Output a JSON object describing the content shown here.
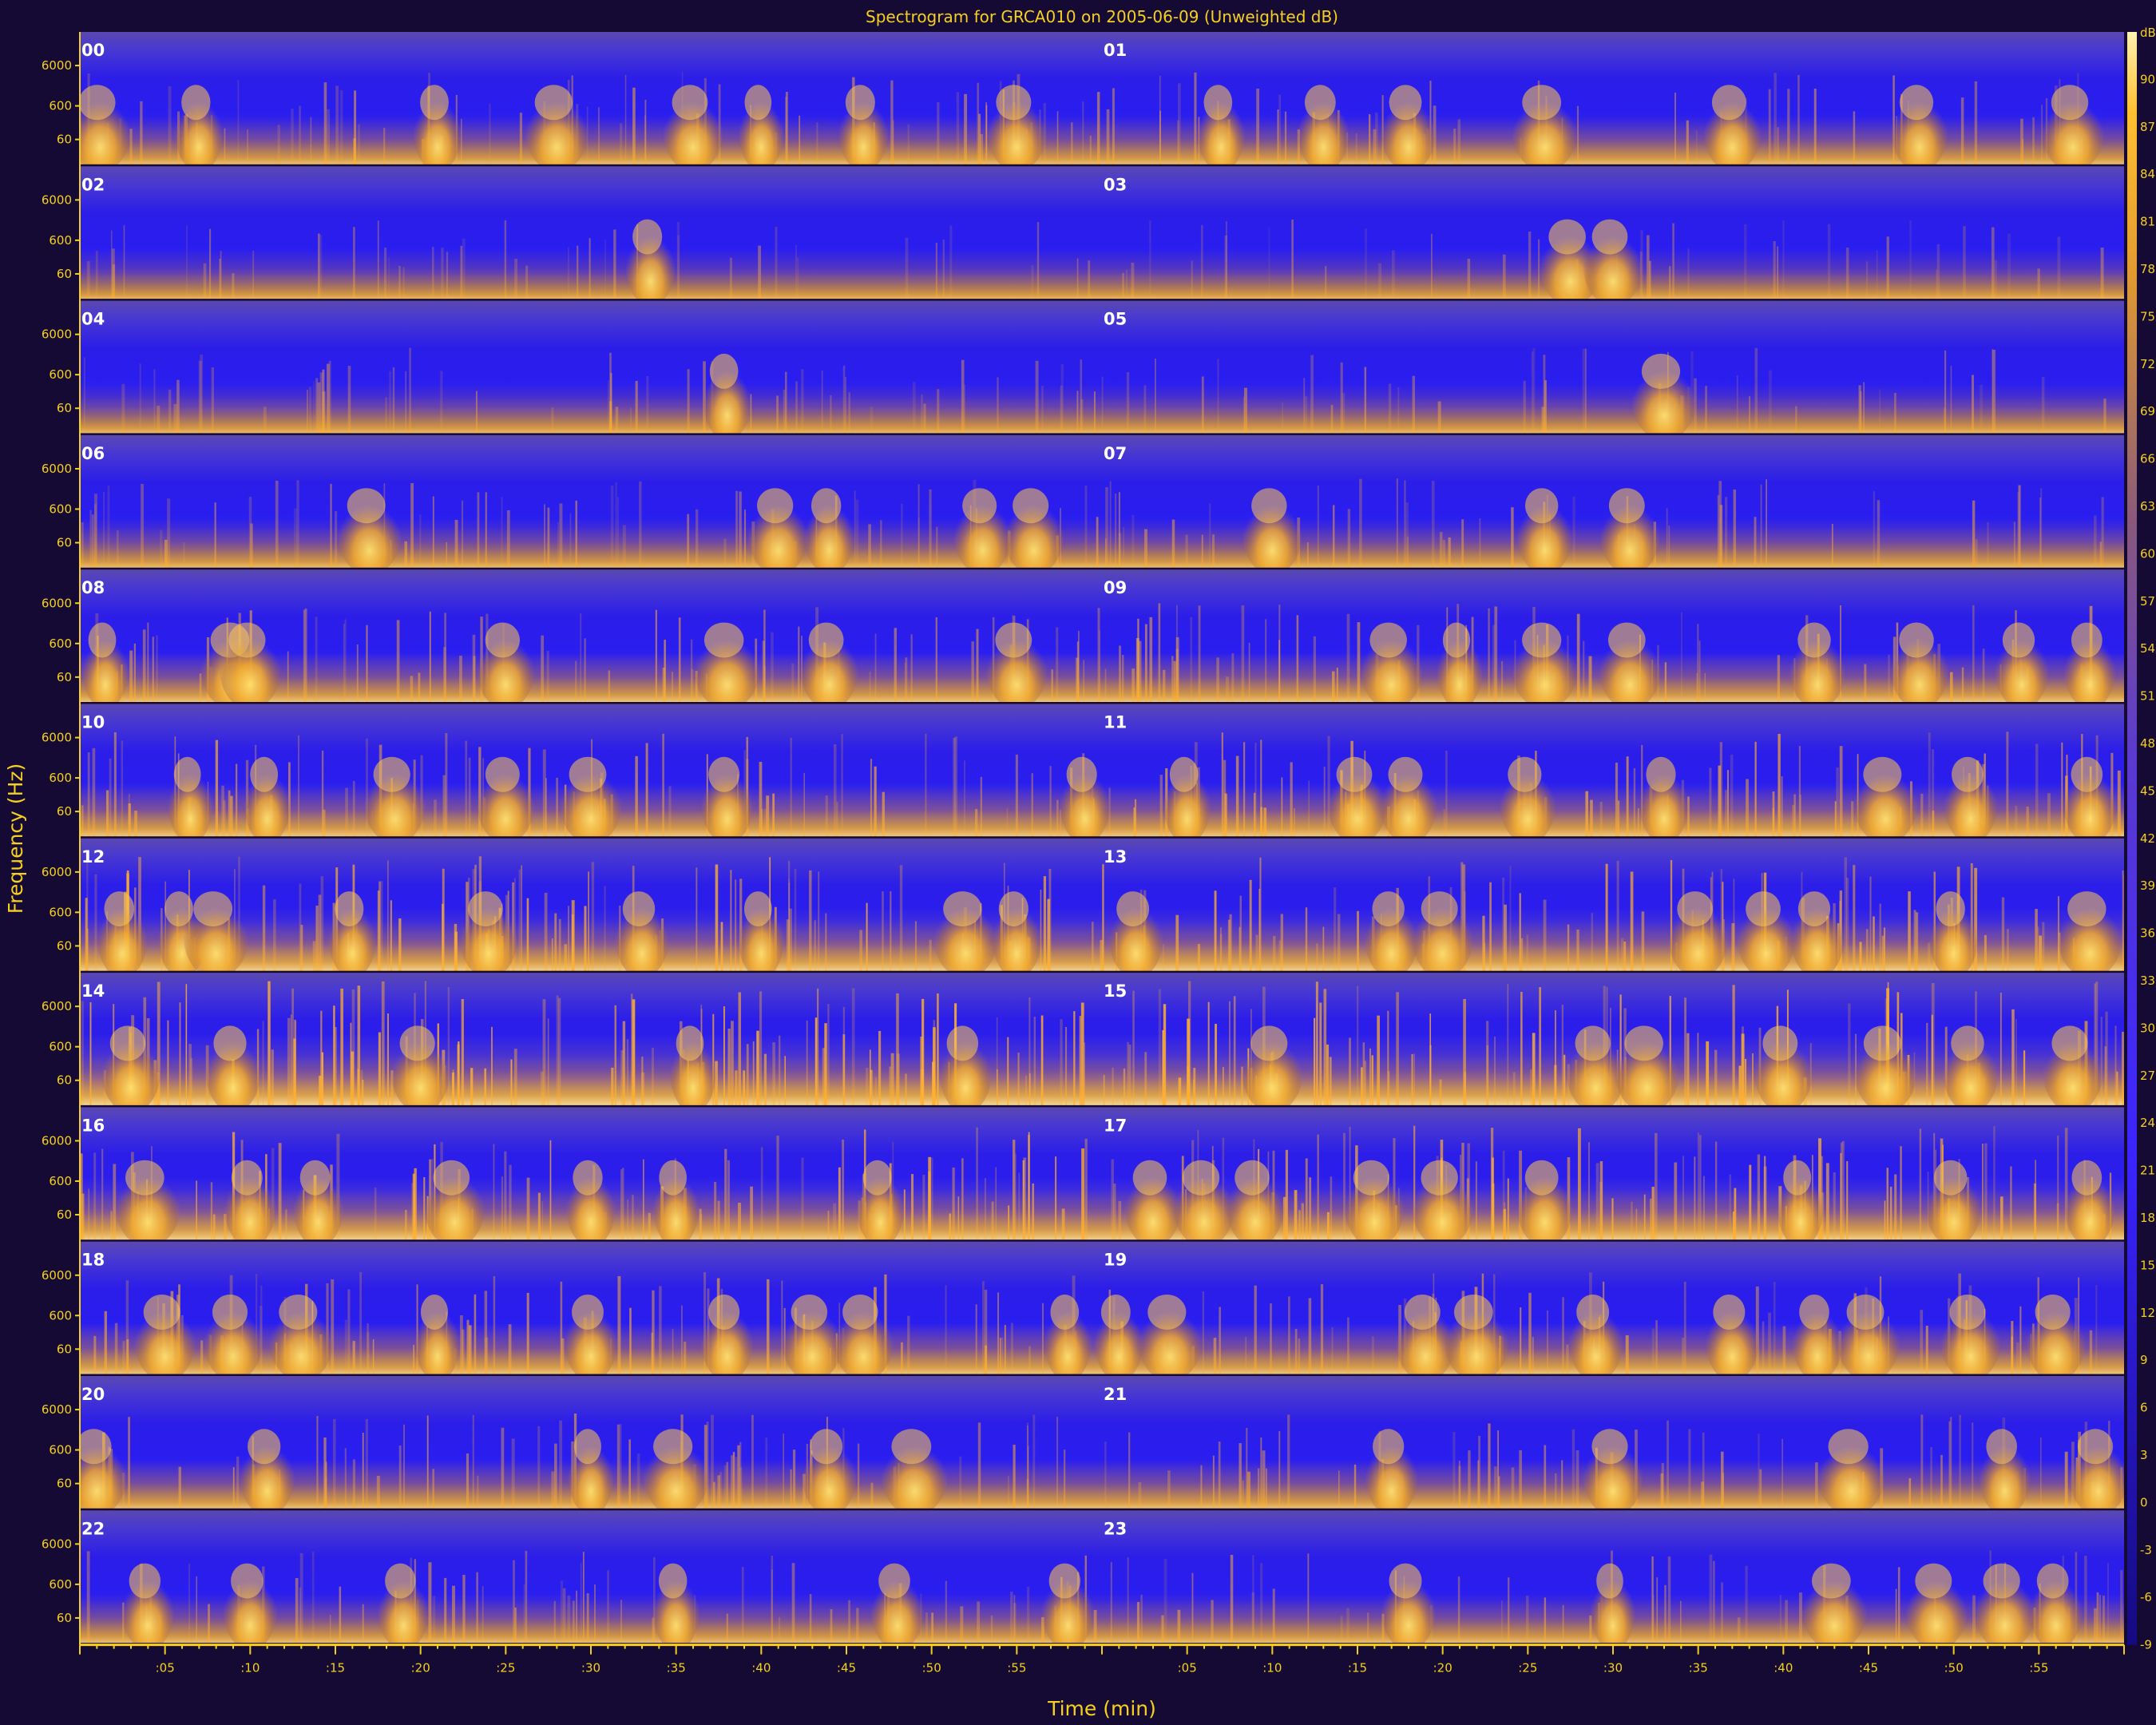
{
  "chart_data": {
    "type": "heatmap",
    "title": "Spectrogram for GRCA010 on 2005-06-09 (Unweighted dB)",
    "xlabel": "Time (min)",
    "ylabel": "Frequency (Hz)",
    "colorbar_unit": "dB",
    "y_tick_labels": [
      "6000",
      "600",
      "60"
    ],
    "x_tick_labels": [
      ":05",
      ":10",
      ":15",
      ":20",
      ":25",
      ":30",
      ":35",
      ":40",
      ":45",
      ":50",
      ":55"
    ],
    "hour_labels": [
      "00",
      "01",
      "02",
      "03",
      "04",
      "05",
      "06",
      "07",
      "08",
      "09",
      "10",
      "11",
      "12",
      "13",
      "14",
      "15",
      "16",
      "17",
      "18",
      "19",
      "20",
      "21",
      "22",
      "23"
    ],
    "colorbar_ticks": [
      90,
      87,
      84,
      81,
      78,
      75,
      72,
      69,
      66,
      63,
      60,
      57,
      54,
      51,
      48,
      45,
      42,
      39,
      36,
      33,
      30,
      27,
      24,
      21,
      18,
      15,
      12,
      9,
      6,
      3,
      0,
      -3,
      -6,
      -9
    ],
    "colorbar_range": [
      -9,
      93
    ],
    "x_range_min": [
      0,
      60
    ],
    "colors": {
      "background": "#140a33",
      "low": "#2b1ee6",
      "mid": "#a0703a",
      "high": "#ffb020",
      "peak": "#fff6c8",
      "text": "#f5d020"
    },
    "panels": [
      {
        "hours": [
          "00",
          "01"
        ],
        "loudness": 0.35,
        "events": [
          1.2,
          7,
          21,
          28,
          36,
          40,
          46,
          55,
          67,
          73,
          78,
          86,
          97,
          108,
          117
        ]
      },
      {
        "hours": [
          "02",
          "03"
        ],
        "loudness": 0.15,
        "events": [
          33.5,
          87.5,
          90
        ]
      },
      {
        "hours": [
          "04",
          "05"
        ],
        "loudness": 0.25,
        "events": [
          38,
          93
        ]
      },
      {
        "hours": [
          "06",
          "07"
        ],
        "loudness": 0.3,
        "events": [
          17,
          41,
          44,
          53,
          56,
          70,
          86,
          91
        ]
      },
      {
        "hours": [
          "08",
          "09"
        ],
        "loudness": 0.45,
        "events": [
          1.5,
          9,
          10,
          25,
          38,
          44,
          55,
          77,
          81,
          86,
          91,
          102,
          108,
          114,
          118
        ]
      },
      {
        "hours": [
          "10",
          "11"
        ],
        "loudness": 0.55,
        "events": [
          6.5,
          11,
          18.5,
          25,
          30,
          38,
          59,
          65,
          75,
          78,
          85,
          93,
          106,
          111,
          118
        ]
      },
      {
        "hours": [
          "12",
          "13"
        ],
        "loudness": 0.7,
        "events": [
          2.5,
          6,
          8,
          16,
          24,
          33,
          40,
          52,
          55,
          62,
          77,
          80,
          95,
          99,
          102,
          110,
          118
        ]
      },
      {
        "hours": [
          "14",
          "15"
        ],
        "loudness": 0.85,
        "events": [
          3,
          9,
          20,
          36,
          52,
          70,
          89,
          92,
          100,
          106,
          111,
          117
        ]
      },
      {
        "hours": [
          "16",
          "17"
        ],
        "loudness": 0.7,
        "events": [
          4,
          10,
          14,
          22,
          30,
          35,
          47,
          63,
          66,
          69,
          76,
          80,
          86,
          101,
          110,
          118
        ]
      },
      {
        "hours": [
          "18",
          "19"
        ],
        "loudness": 0.5,
        "events": [
          5,
          9,
          13,
          21,
          30,
          38,
          43,
          46,
          58,
          61,
          64,
          79,
          82,
          89,
          97,
          102,
          105,
          111,
          116
        ]
      },
      {
        "hours": [
          "20",
          "21"
        ],
        "loudness": 0.4,
        "events": [
          1,
          11,
          30,
          35,
          44,
          49,
          77,
          90,
          104,
          113,
          118.5
        ]
      },
      {
        "hours": [
          "22",
          "23"
        ],
        "loudness": 0.35,
        "events": [
          4,
          10,
          19,
          35,
          48,
          58,
          78,
          90,
          103,
          109,
          113,
          116
        ]
      }
    ]
  }
}
